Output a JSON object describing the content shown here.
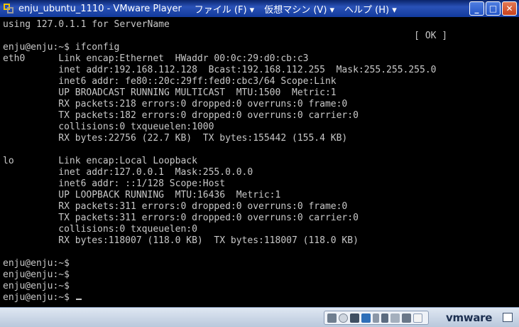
{
  "window": {
    "title": "enju_ubuntu_1110 - VMware Player",
    "menus": [
      "ファイル (F) ▾",
      "仮想マシン (V) ▾",
      "ヘルプ (H) ▾"
    ],
    "buttons": {
      "minimize": "_",
      "maximize": "□",
      "close": "✕"
    }
  },
  "terminal": {
    "lines": [
      "using 127.0.1.1 for ServerName",
      "                                                                          [ OK ]",
      "enju@enju:~$ ifconfig",
      "eth0      Link encap:Ethernet  HWaddr 00:0c:29:d0:cb:c3",
      "          inet addr:192.168.112.128  Bcast:192.168.112.255  Mask:255.255.255.0",
      "          inet6 addr: fe80::20c:29ff:fed0:cbc3/64 Scope:Link",
      "          UP BROADCAST RUNNING MULTICAST  MTU:1500  Metric:1",
      "          RX packets:218 errors:0 dropped:0 overruns:0 frame:0",
      "          TX packets:182 errors:0 dropped:0 overruns:0 carrier:0",
      "          collisions:0 txqueuelen:1000",
      "          RX bytes:22756 (22.7 KB)  TX bytes:155442 (155.4 KB)",
      "",
      "lo        Link encap:Local Loopback",
      "          inet addr:127.0.0.1  Mask:255.0.0.0",
      "          inet6 addr: ::1/128 Scope:Host",
      "          UP LOOPBACK RUNNING  MTU:16436  Metric:1",
      "          RX packets:311 errors:0 dropped:0 overruns:0 frame:0",
      "          TX packets:311 errors:0 dropped:0 overruns:0 carrier:0",
      "          collisions:0 txqueuelen:0",
      "          RX bytes:118007 (118.0 KB)  TX bytes:118007 (118.0 KB)",
      "",
      "enju@enju:~$",
      "enju@enju:~$",
      "enju@enju:~$",
      "enju@enju:~$ "
    ]
  },
  "statusbar": {
    "devices": [
      "hard-disk-icon",
      "cd-rom-icon",
      "floppy-icon",
      "network-adapter-icon",
      "usb-icon",
      "sound-card-icon",
      "printer-icon",
      "webcam-icon",
      "message-log-icon"
    ],
    "brand": "vmware",
    "fullscreen_icon": "fullscreen-icon"
  },
  "colors": {
    "titlebar": "#2a52b8",
    "terminal_bg": "#000000",
    "terminal_fg": "#c8c8c8",
    "statusbar": "#c9d6e8"
  }
}
